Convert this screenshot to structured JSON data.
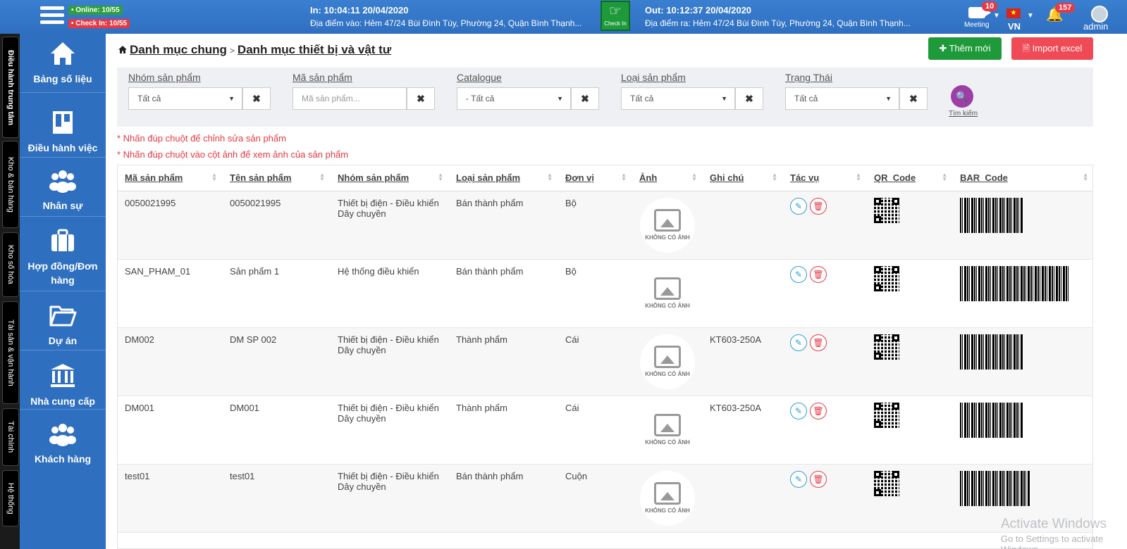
{
  "topbar": {
    "online": "• Online: 10/55",
    "checkin_count": "• Check In: 10/55",
    "in_time": "In: 10:04:11 20/04/2020",
    "in_place": "Địa điểm vào: Hẻm 47/24 Bùi Đình Túy, Phường 24, Quận Bình Thạnh...",
    "checkin_btn": "Check In",
    "out_time": "Out: 10:12:37 20/04/2020",
    "out_place": "Địa điểm ra: Hẻm 47/24 Bùi Đình Túy, Phường 24, Quận Bình Thạnh...",
    "meeting": "Meeting",
    "meeting_count": "10",
    "lang": "VN",
    "notif_count": "157",
    "user": "admin"
  },
  "vtabs": [
    "Điều hành trung tâm",
    "Kho & bán hàng",
    "Kho số hóa",
    "Tài sản & vận hành",
    "Tài chính",
    "Hệ thống"
  ],
  "sidebar": {
    "items": [
      {
        "label": "Bảng số liệu",
        "icon": "home-icon"
      },
      {
        "label": "Điều hành việc",
        "icon": "board-icon"
      },
      {
        "label": "Nhân sự",
        "icon": "people-icon"
      },
      {
        "label": "Hợp đồng/Đơn hàng",
        "icon": "briefcase-icon"
      },
      {
        "label": "Dự án",
        "icon": "folder-icon"
      },
      {
        "label": "Nhà cung cấp",
        "icon": "bank-icon"
      },
      {
        "label": "Khách hàng",
        "icon": "customers-icon"
      }
    ]
  },
  "breadcrumb": {
    "root": "Danh mục chung",
    "sep": ">",
    "current": "Danh mục thiết bị và vật tư"
  },
  "actions": {
    "add": "Thêm mới",
    "import": "Import excel"
  },
  "filters": {
    "group_label": "Nhóm sản phẩm",
    "group_value": "Tất cả",
    "code_label": "Mã sản phẩm",
    "code_placeholder": "Mã sản phẩm...",
    "catalogue_label": "Catalogue",
    "catalogue_value": "- Tất cả",
    "type_label": "Loại sản phẩm",
    "type_value": "Tất cả",
    "status_label": "Trạng Thái",
    "status_value": "Tất cả",
    "search_label": "Tìm kiếm"
  },
  "notes": [
    "* Nhấn đúp chuột để chỉnh sửa sản phẩm",
    "* Nhấn đúp chuột vào cột ảnh để xem ảnh của sản phẩm"
  ],
  "table": {
    "headers": [
      "Mã sản phẩm",
      "Tên sản phẩm",
      "Nhóm sản phẩm",
      "Loại sản phẩm",
      "Đơn vị",
      "Ảnh",
      "Ghi chú",
      "Tác vụ",
      "QR_Code",
      "BAR_Code"
    ],
    "no_image": "KHÔNG CÓ ẢNH",
    "rows": [
      {
        "code": "0050021995",
        "name": "0050021995",
        "group": "Thiết bị điện - Điều khiển Dây chuyền",
        "type": "Bán thành phẩm",
        "unit": "Bộ",
        "note": ""
      },
      {
        "code": "SAN_PHAM_01",
        "name": "Sản phẩm 1",
        "group": "Hệ thống điều khiển",
        "type": "Bán thành phẩm",
        "unit": "Bộ",
        "note": ""
      },
      {
        "code": "DM002",
        "name": "DM SP 002",
        "group": "Thiết bị điện - Điều khiển Dây chuyền",
        "type": "Thành phẩm",
        "unit": "Cái",
        "note": "KT603-250A"
      },
      {
        "code": "DM001",
        "name": "DM001",
        "group": "Thiết bị điện - Điều khiển Dây chuyền",
        "type": "Thành phẩm",
        "unit": "Cái",
        "note": "KT603-250A"
      },
      {
        "code": "test01",
        "name": "test01",
        "group": "Thiết bị điện - Điều khiển Dây chuyền",
        "type": "Bán thành phẩm",
        "unit": "Cuộn",
        "note": ""
      }
    ]
  },
  "watermark": {
    "line1": "Activate Windows",
    "line2": "Go to Settings to activate Windows."
  }
}
